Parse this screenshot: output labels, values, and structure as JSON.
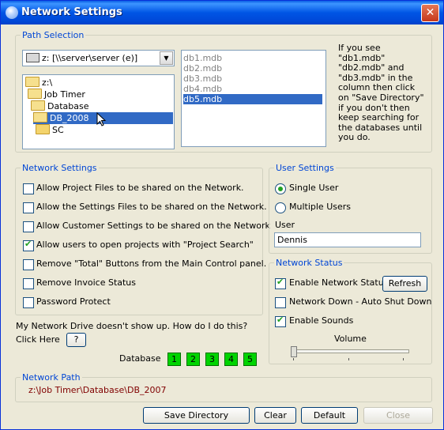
{
  "window": {
    "title": "Network Settings",
    "close_glyph": "✕"
  },
  "path_selection": {
    "legend": "Path Selection",
    "drive_combo_value": "z: [\\\\server\\server (e)]",
    "drive_icon": "network-drive-icon",
    "folder_tree": [
      "z:\\",
      "Job Timer",
      "Database",
      "DB_2008",
      "SC"
    ],
    "selected_folder": "DB_2008",
    "databases": [
      "db1.mdb",
      "db2.mdb",
      "db3.mdb",
      "db4.mdb",
      "db5.mdb"
    ],
    "selected_database": "db5.mdb",
    "help_text": "If you see \"db1.mdb\" \"db2.mdb\" and \"db3.mdb\" in the column then click on \"Save Directory\" if you don't then keep searching for the databases until you do."
  },
  "network_settings": {
    "legend": "Network Settings",
    "options": [
      {
        "label": "Allow Project Files to be shared on the Network.",
        "checked": false
      },
      {
        "label": "Allow the Settings Files to be shared on the Network.",
        "checked": false
      },
      {
        "label": "Allow Customer Settings to be shared on the Network",
        "checked": false
      },
      {
        "label": "Allow users to open projects with \"Project Search\"",
        "checked": true
      },
      {
        "label": "Remove \"Total\" Buttons from the Main Control panel.",
        "checked": false
      },
      {
        "label": "Remove Invoice Status",
        "checked": false
      },
      {
        "label": "Password Protect",
        "checked": false
      }
    ]
  },
  "user_settings": {
    "legend": "User Settings",
    "single_user_label": "Single User",
    "multiple_users_label": "Multiple Users",
    "selected_mode": "Single User",
    "user_label": "User",
    "user_value": "Dennis"
  },
  "network_status": {
    "legend": "Network Status",
    "enable_network_status_label": "Enable Network Status",
    "enable_network_status_checked": true,
    "refresh_label": "Refresh",
    "network_down_label": "Network Down - Auto Shut Down",
    "network_down_checked": false,
    "enable_sounds_label": "Enable Sounds",
    "enable_sounds_checked": true,
    "volume_label": "Volume",
    "volume_level_fraction": 0.0
  },
  "help": {
    "question": "My Network Drive doesn't show up. How do I do this?",
    "click_here": "Click Here",
    "help_button": "?"
  },
  "database_buttons": {
    "label": "Database",
    "numbers": [
      "1",
      "2",
      "3",
      "4",
      "5"
    ],
    "color": "#00d400"
  },
  "network_path": {
    "legend": "Network Path",
    "value": "z:\\Job Timer\\Database\\DB_2007",
    "color": "#800000"
  },
  "buttons": {
    "save_directory": "Save Directory",
    "clear": "Clear",
    "default": "Default",
    "close": "Close"
  }
}
